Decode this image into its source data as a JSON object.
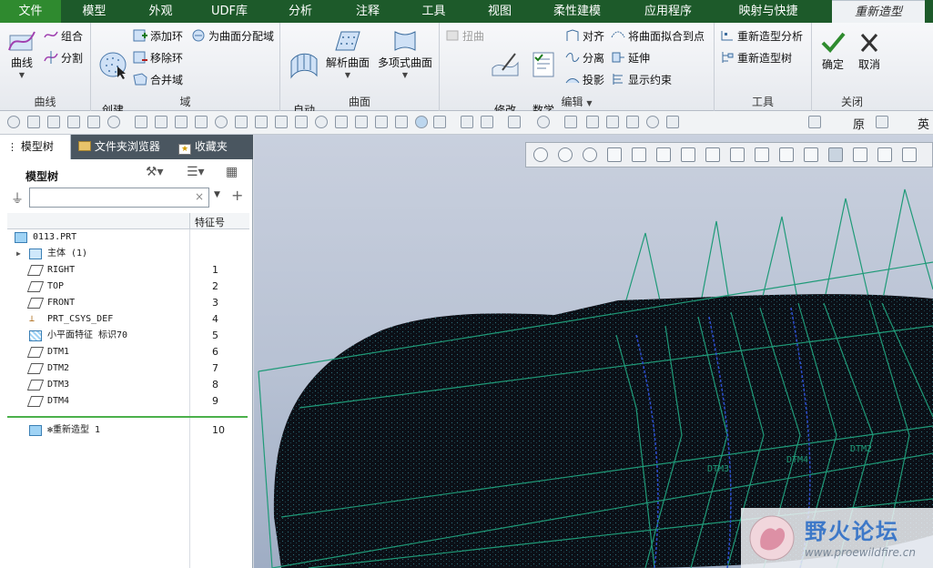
{
  "menu": {
    "tabs": [
      "文件",
      "模型",
      "外观",
      "UDF库",
      "分析",
      "注释",
      "工具",
      "视图",
      "柔性建模",
      "应用程序",
      "映射与快捷",
      "重新造型"
    ]
  },
  "ribbon": {
    "curve_group": {
      "label": "曲线",
      "big": "曲线",
      "combine": "组合",
      "split": "分割"
    },
    "domain_group": {
      "label": "域",
      "create_domain": "创建\n域",
      "add_loop": "添加环",
      "remove_loop": "移除环",
      "merge_domain": "合并域",
      "assign_domain": "为曲面分配域"
    },
    "surface_group": {
      "label": "曲面",
      "auto_surface": "自动\n曲面",
      "analytic_surface": "解析曲面",
      "poly_surface": "多项式曲面"
    },
    "edit_group": {
      "label": "编辑",
      "twist": "扭曲",
      "modify_shape": "修改\n形状",
      "math_prop": "数学\n属性",
      "align": "对齐",
      "fit_surface": "将曲面拟合到点",
      "separate": "分离",
      "extend": "延伸",
      "project": "投影",
      "show_constraint": "显示约束"
    },
    "tools_group": {
      "label": "工具",
      "reshape_analysis": "重新造型分析",
      "reshape_tree": "重新造型树"
    },
    "close_group": {
      "label": "关闭",
      "ok": "确定",
      "cancel": "取消"
    }
  },
  "panel": {
    "tabs": {
      "model_tree": "模型树",
      "folder_browser": "文件夹浏览器",
      "favorites": "收藏夹"
    },
    "title": "模型树",
    "col_feature_id": "特征号",
    "search_placeholder": "",
    "rows": [
      {
        "name": "0113.PRT",
        "id": ""
      },
      {
        "name": "主体 (1)",
        "id": ""
      },
      {
        "name": "RIGHT",
        "id": "1"
      },
      {
        "name": "TOP",
        "id": "2"
      },
      {
        "name": "FRONT",
        "id": "3"
      },
      {
        "name": "PRT_CSYS_DEF",
        "id": "4"
      },
      {
        "name": "小平面特征 标识70",
        "id": "5"
      },
      {
        "name": "DTM1",
        "id": "6"
      },
      {
        "name": "DTM2",
        "id": "7"
      },
      {
        "name": "DTM3",
        "id": "8"
      },
      {
        "name": "DTM4",
        "id": "9"
      },
      {
        "name": "重新造型 1",
        "id": "10"
      }
    ]
  },
  "viewport": {
    "labels": [
      "DTM3",
      "DTM4",
      "DTM2"
    ],
    "watermark_title": "野火论坛",
    "watermark_url": "www.proewildfire.cn"
  },
  "toolbar": {
    "right_chars": [
      "原",
      "英"
    ]
  },
  "colors": {
    "menu_bg": "#1d5a2a",
    "file_tab": "#2f8a2f",
    "mesh": "#1f9a78",
    "model": "#0b0f16"
  }
}
